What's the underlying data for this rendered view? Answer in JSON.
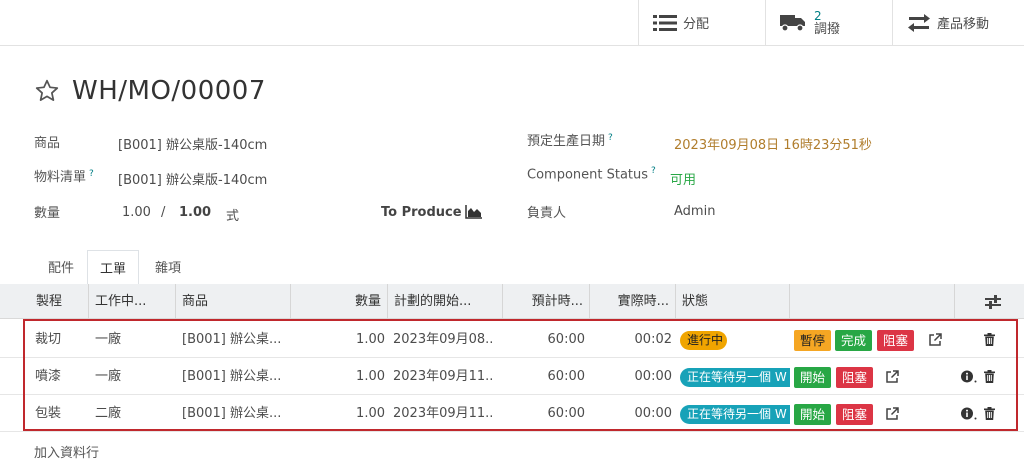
{
  "topbar": {
    "assign_label": "分配",
    "transfer_count": "2",
    "transfer_label": "調撥",
    "product_moves_label": "產品移動"
  },
  "record": {
    "title": "WH/MO/00007"
  },
  "fields": {
    "product_label": "商品",
    "product_value": "[B001] 辦公桌版-140cm",
    "bom_label": "物料清單",
    "bom_value": "[B001] 辦公桌版-140cm",
    "qty_label": "數量",
    "qty_done": "1.00",
    "qty_sep": "/",
    "qty_total": "1.00",
    "qty_uom": "式",
    "to_produce_label": "To Produce",
    "scheduled_label": "預定生產日期",
    "scheduled_value": "2023年09月08日 16時23分51秒",
    "component_status_label": "Component Status",
    "component_status_value": "可用",
    "responsible_label": "負責人",
    "responsible_value": "Admin",
    "help_mark": "?"
  },
  "tabs": [
    {
      "label": "配件"
    },
    {
      "label": "工單"
    },
    {
      "label": "雜項"
    }
  ],
  "table": {
    "headers": [
      "製程",
      "工作中...",
      "商品",
      "數量",
      "計劃的開始...",
      "預計時...",
      "實際時...",
      "狀態"
    ],
    "rows": [
      {
        "operation": "裁切",
        "workcenter": "一廠",
        "product": "[B001] 辦公桌...",
        "qty": "1.00",
        "start": "2023年09月08...",
        "expected": "60:00",
        "real": "00:02",
        "status": "進行中",
        "actions": [
          "暫停",
          "完成",
          "阻塞"
        ]
      },
      {
        "operation": "噴漆",
        "workcenter": "一廠",
        "product": "[B001] 辦公桌...",
        "qty": "1.00",
        "start": "2023年09月11...",
        "expected": "60:00",
        "real": "00:00",
        "status": "正在等待另一個 W",
        "actions": [
          "開始",
          "阻塞"
        ]
      },
      {
        "operation": "包裝",
        "workcenter": "二廠",
        "product": "[B001] 辦公桌...",
        "qty": "1.00",
        "start": "2023年09月11...",
        "expected": "60:00",
        "real": "00:00",
        "status": "正在等待另一個 W",
        "actions": [
          "開始",
          "阻塞"
        ]
      }
    ],
    "add_line_label": "加入資料行"
  },
  "colors": {
    "accent": "#017e84",
    "highlight": "#c0282d",
    "badge_progress": "#f0a500",
    "badge_waiting": "#17a2b8",
    "btn_green": "#28a745",
    "btn_red": "#dc3545",
    "btn_yellow": "#f5a623"
  }
}
